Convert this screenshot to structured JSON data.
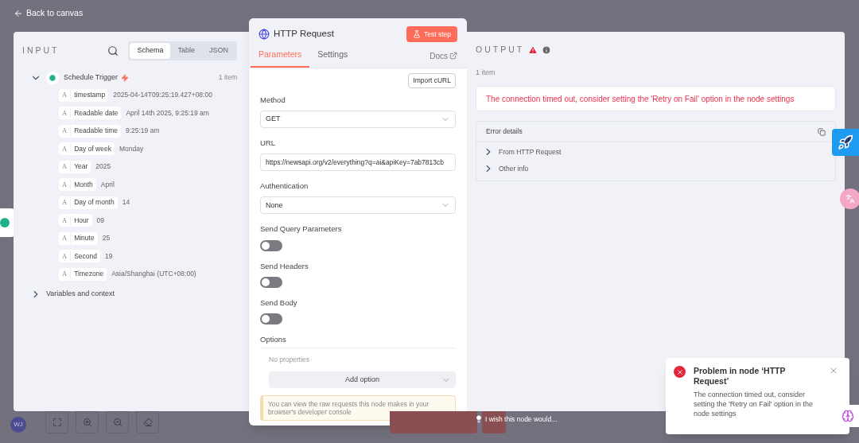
{
  "back_link": "Back to canvas",
  "input": {
    "title": "INPUT",
    "view_tabs": [
      {
        "label": "Schema",
        "selected": true
      },
      {
        "label": "Table",
        "selected": false
      },
      {
        "label": "JSON",
        "selected": false
      }
    ],
    "source": {
      "name": "Schedule Trigger",
      "count": "1 item",
      "expanded": true,
      "fields": [
        {
          "type": "A",
          "name": "timestamp",
          "value": "2025-04-14T09:25:19.427+08:00"
        },
        {
          "type": "A",
          "name": "Readable date",
          "value": "April 14th 2025, 9:25:19 am"
        },
        {
          "type": "A",
          "name": "Readable time",
          "value": "9:25:19 am"
        },
        {
          "type": "A",
          "name": "Day of week",
          "value": "Monday"
        },
        {
          "type": "A",
          "name": "Year",
          "value": "2025"
        },
        {
          "type": "A",
          "name": "Month",
          "value": "April"
        },
        {
          "type": "A",
          "name": "Day of month",
          "value": "14"
        },
        {
          "type": "A",
          "name": "Hour",
          "value": "09"
        },
        {
          "type": "A",
          "name": "Minute",
          "value": "25"
        },
        {
          "type": "A",
          "name": "Second",
          "value": "19"
        },
        {
          "type": "A",
          "name": "Timezone",
          "value": "Asia/Shanghai (UTC+08:00)"
        }
      ]
    },
    "variables": {
      "label": "Variables and context",
      "expanded": false
    }
  },
  "node": {
    "title": "HTTP Request",
    "test_button": "Test step",
    "tabs": [
      {
        "label": "Parameters",
        "selected": true
      },
      {
        "label": "Settings",
        "selected": false
      }
    ],
    "docs": "Docs",
    "import_button": "Import cURL",
    "params": [
      {
        "kind": "select",
        "label": "Method",
        "value": "GET"
      },
      {
        "kind": "text",
        "label": "URL",
        "value": "https://newsapi.org/v2/everything?q=ai&apiKey=7ab7813cb"
      },
      {
        "kind": "select",
        "label": "Authentication",
        "value": "None"
      },
      {
        "kind": "toggle",
        "label": "Send Query Parameters",
        "on": false
      },
      {
        "kind": "toggle",
        "label": "Send Headers",
        "on": false
      },
      {
        "kind": "toggle",
        "label": "Send Body",
        "on": false
      }
    ],
    "options": {
      "label": "Options",
      "empty": "No properties",
      "add": "Add option"
    },
    "notice": "You can view the raw requests this node makes in your browser's developer console"
  },
  "output": {
    "title": "OUTPUT",
    "count": "1 item",
    "error": "The connection timed out, consider setting the 'Retry on Fail' option in the node settings",
    "details": {
      "title": "Error details",
      "items": [
        {
          "label": "From HTTP Request",
          "expanded": false
        },
        {
          "label": "Other info",
          "expanded": false
        }
      ]
    }
  },
  "footer": {
    "feedback": "I wish this node would..."
  },
  "avatar": "WJ",
  "toast": {
    "title": "Problem in node ‘HTTP Request’",
    "message": "The connection timed out, consider setting the 'Retry on Fail' option in the node settings"
  }
}
